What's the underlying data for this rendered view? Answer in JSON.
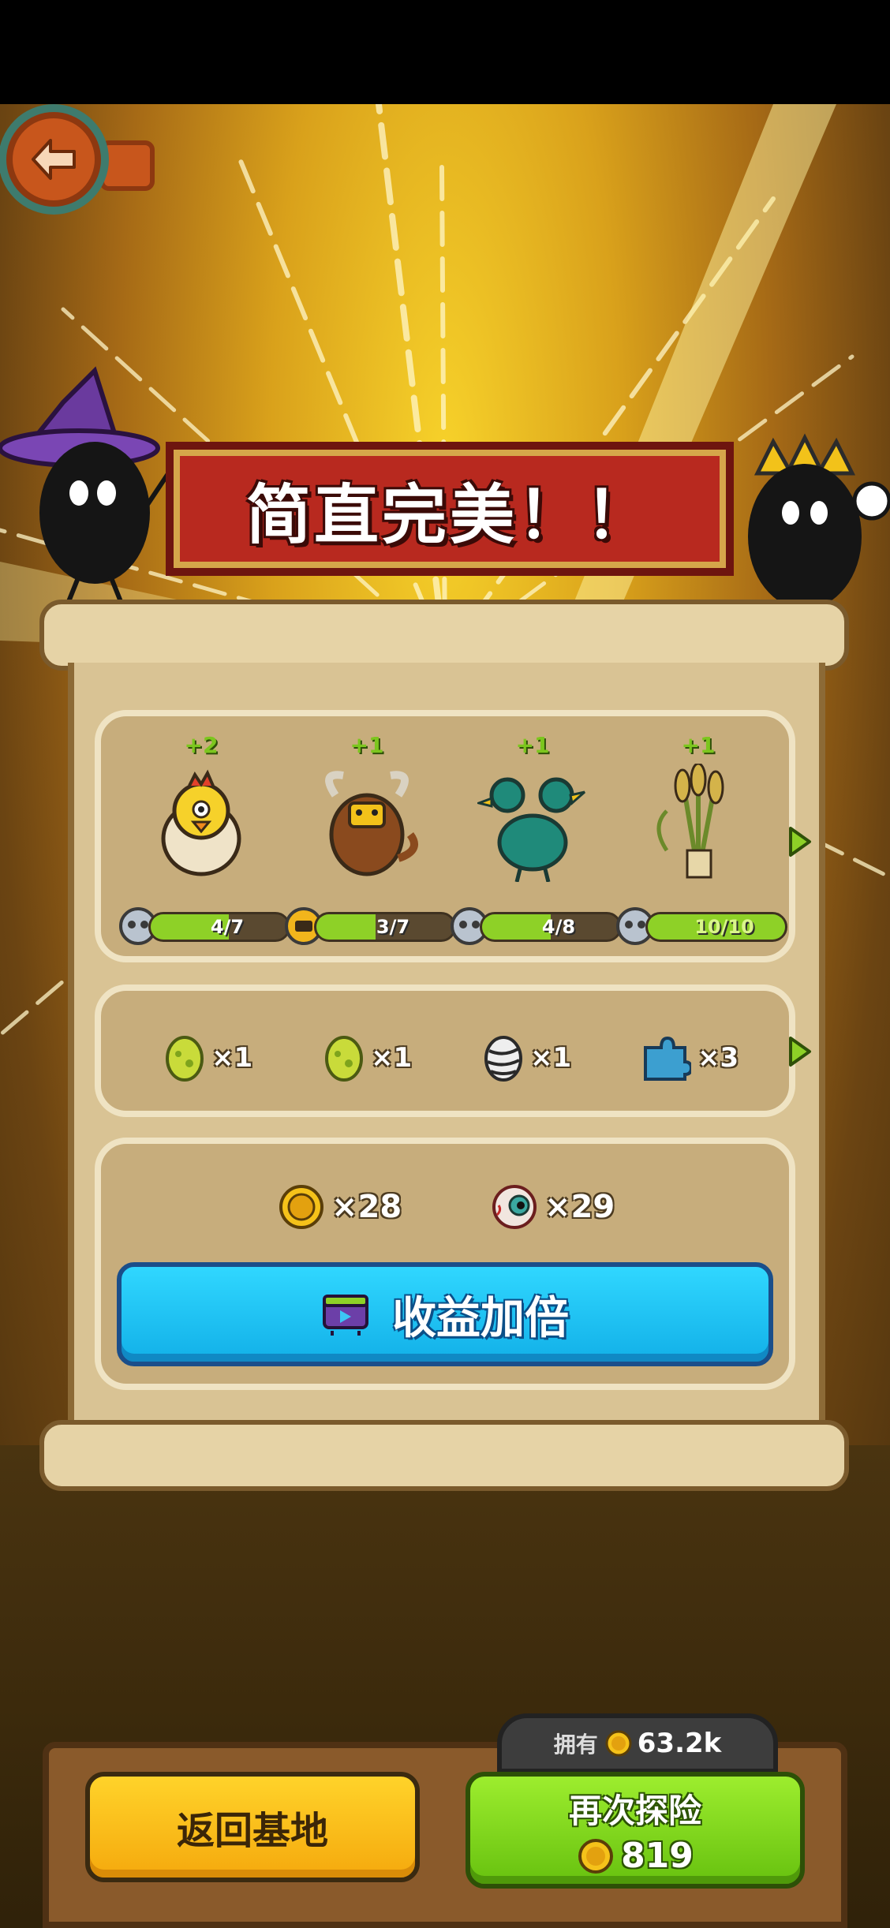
{
  "banner": {
    "title": "简直完美！！"
  },
  "monsters": [
    {
      "plus": "+2",
      "progress_text": "4/7",
      "progress_fraction": 0.571,
      "icon": "skull-badge-icon",
      "art": "chick-egg-icon"
    },
    {
      "plus": "+1",
      "progress_text": "3/7",
      "progress_fraction": 0.429,
      "icon": "beast-badge-icon",
      "art": "yak-monster-icon"
    },
    {
      "plus": "+1",
      "progress_text": "4/8",
      "progress_fraction": 0.5,
      "icon": "skull-badge-icon",
      "art": "two-headed-bird-icon"
    },
    {
      "plus": "+1",
      "progress_text": "10/10",
      "progress_fraction": 1.0,
      "icon": "skull-badge-icon",
      "art": "wheat-bundle-icon"
    }
  ],
  "items": [
    {
      "icon": "green-egg-icon",
      "count": "×1"
    },
    {
      "icon": "green-egg-icon",
      "count": "×1"
    },
    {
      "icon": "striped-egg-icon",
      "count": "×1"
    },
    {
      "icon": "puzzle-piece-icon",
      "count": "×3"
    }
  ],
  "currency": [
    {
      "icon": "gold-coin-icon",
      "count": "×28"
    },
    {
      "icon": "eyeball-icon",
      "count": "×29"
    }
  ],
  "double_button": {
    "label": "收益加倍",
    "icon": "tv-ad-icon"
  },
  "bottom": {
    "home_label": "返回基地",
    "own_label": "拥有",
    "own_value": "63.2k",
    "explore_label": "再次探险",
    "explore_cost": "819"
  },
  "colors": {
    "banner_red": "#b8291f",
    "progress_green": "#8ed127",
    "double_blue": "#1fc4f5",
    "home_yellow": "#fbbf1c",
    "explore_green": "#7fd51c"
  }
}
